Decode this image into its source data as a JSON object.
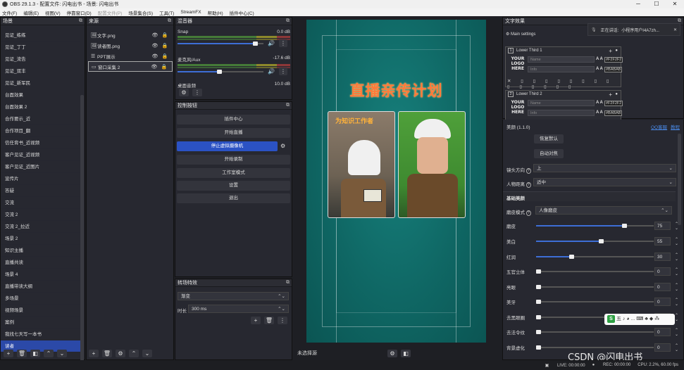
{
  "window": {
    "title": "OBS 29.1.3 - 配置文件: 闪电出书 - 场景: 闪电出书",
    "minimize": "─",
    "maximize": "☐",
    "close": "✕"
  },
  "menu": [
    "文件(F)",
    "编辑(E)",
    "视图(V)",
    "停靠窗口(D)",
    "配置文件(P)",
    "场景集合(S)",
    "工具(T)",
    "StreamFX",
    "帮助(H)",
    "插件中心(C)"
  ],
  "menu_disabled": [
    false,
    false,
    false,
    false,
    true,
    false,
    false,
    false,
    false,
    false
  ],
  "scenes": {
    "title": "场景",
    "items": [
      "见证_练练",
      "见证_丁丁",
      "见证_流告",
      "见证_双丰",
      "见证_新军民",
      "台面效果",
      "台面效果 2",
      "合作要示_近",
      "合作项目_翻",
      "信任背书_近视频",
      "客户见证_近视频",
      "客户见证_近图片",
      "宣传片",
      "答疑",
      "交流",
      "交流 2",
      "交流 2_拉近",
      "场景 2",
      "知识主播",
      "直播共读",
      "场景 4",
      "直播带读大纲",
      "多场景",
      "视频场景",
      "案例",
      "我找七天写一本书",
      "读者"
    ],
    "selected_index": 26
  },
  "sources": {
    "title": "来源",
    "items": [
      {
        "icon": "🖼",
        "name": "文字.png"
      },
      {
        "icon": "🖼",
        "name": "读者图.png"
      },
      {
        "icon": "☰",
        "name": "PPT展示"
      },
      {
        "icon": "▭",
        "name": "窗口采集 2"
      }
    ],
    "selected_index": 3
  },
  "mixer": {
    "title": "混音器",
    "channels": [
      {
        "name": "Snap",
        "db": "0.0 dB",
        "volume": 0.9
      },
      {
        "name": "麦克风/Aux",
        "db": "-17.6 dB",
        "volume": 0.48
      },
      {
        "name": "桌面音频",
        "db": "10.0 dB",
        "volume": 0.5
      }
    ]
  },
  "controls": {
    "title": "控制按钮",
    "buttons": [
      "插件中心",
      "开始直播",
      "停止虚拟摄像机",
      "开始录制",
      "工作室模式",
      "设置",
      "退出"
    ],
    "active_index": 2
  },
  "transitions": {
    "title": "转场特效",
    "type": "渐变",
    "duration_label": "时长",
    "duration": "300 ms"
  },
  "preview": {
    "title_text": "直播亲传计划",
    "inner_caption": "为知识工作者"
  },
  "bottom": {
    "status": "未选择源"
  },
  "text_effects": {
    "title": "文字效果",
    "main_settings": "Main settings",
    "lower_thirds": [
      {
        "num": "1",
        "label": "Lower Third 1",
        "name_ph": "Name",
        "info_ph": "Info",
        "color1": "#F2F2F2",
        "color2": "#BABAB"
      },
      {
        "num": "2",
        "label": "Lower Third 2",
        "name_ph": "Name",
        "info_ph": "Info",
        "color1": "#F2F2F2",
        "color2": "#BABAB"
      }
    ],
    "logo": "YOUR LOGO HERE"
  },
  "notify": {
    "label": "正在讲话:",
    "text": "小程序用户I4A7zh..."
  },
  "beauty": {
    "version": "美颜 (1.1.0)",
    "qq_link": "QQ客服",
    "tutorial_link": "教程",
    "reset_button": "恢复默认",
    "auto_button": "自动对焦",
    "direction_label": "镜头方向",
    "direction": "上",
    "distance_label": "人物距离",
    "distance": "适中",
    "basic_section": "基础美颜",
    "mode_label": "磨皮模式",
    "mode": "人像磨皮",
    "sliders": [
      {
        "label": "磨皮",
        "value": 75
      },
      {
        "label": "美白",
        "value": 55
      },
      {
        "label": "红润",
        "value": 30
      },
      {
        "label": "五官立体",
        "value": 0
      },
      {
        "label": "亮眼",
        "value": 0
      },
      {
        "label": "美牙",
        "value": 0
      },
      {
        "label": "去黑眼圈",
        "value": 0
      },
      {
        "label": "去法令纹",
        "value": 0
      },
      {
        "label": "背景虚化",
        "value": 0
      }
    ]
  },
  "statusbar": {
    "live": "LIVE: 00:00:00",
    "rec": "REC: 00:00:00",
    "cpu": "CPU: 2.2%, 60.00 fps"
  },
  "watermark": "CSDN @闪电出书",
  "ime": "五 ♪ ◕ ... ⌨ ♣ ◆ ⁂"
}
